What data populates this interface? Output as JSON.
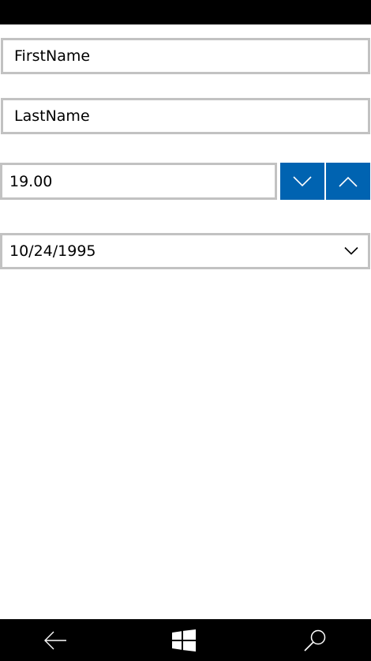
{
  "form": {
    "first_name": "FirstName",
    "last_name": "LastName",
    "numeric_value": "19.00",
    "date_value": "10/24/1995"
  },
  "icons": {
    "spin_down": "chevron-down-icon",
    "spin_up": "chevron-up-icon",
    "date_dropdown": "chevron-down-icon",
    "nav_back": "back-arrow-icon",
    "nav_start": "windows-logo-icon",
    "nav_search": "search-icon"
  },
  "colors": {
    "accent": "#0063b1",
    "border": "#c2c2c2",
    "system_bar": "#000000",
    "background": "#ffffff"
  }
}
